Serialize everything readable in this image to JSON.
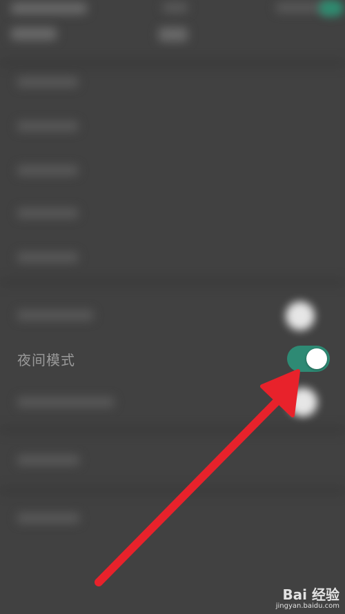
{
  "settings": {
    "night_mode_label": "夜间模式",
    "night_mode_enabled": true
  },
  "colors": {
    "background": "#414141",
    "toggle_on": "#2e8a74",
    "arrow": "#e8222b"
  },
  "watermark": {
    "logo": "Bai 经验",
    "url": "jingyan.baidu.com"
  }
}
